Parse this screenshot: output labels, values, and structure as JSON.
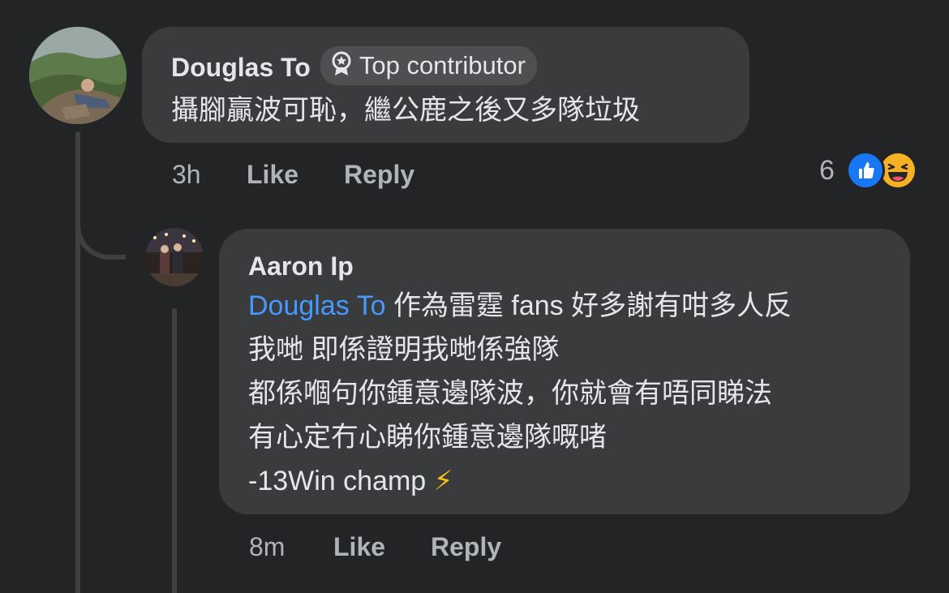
{
  "comment": {
    "author": "Douglas To",
    "badge_label": "Top contributor",
    "text": "攝腳贏波可恥，繼公鹿之後又多隊垃圾",
    "time": "3h",
    "like_label": "Like",
    "reply_label": "Reply",
    "reaction_count": "6",
    "reaction_icons": [
      "like-icon",
      "haha-icon"
    ]
  },
  "reply": {
    "author": "Aaron Ip",
    "mention": "Douglas To",
    "first_line_rest": " 作為雷霆 fans 好多謝有咁多人反",
    "lines": [
      "我哋 即係證明我哋係強隊",
      "都係嗰句你鍾意邊隊波，你就會有唔同睇法",
      "有心定冇心睇你鍾意邊隊嘅啫"
    ],
    "last_line": "-13Win champ ",
    "emoji": "⚡",
    "time": "8m",
    "like_label": "Like",
    "reply_label": "Reply"
  },
  "colors": {
    "background": "#232425",
    "bubble": "#3a3b3c",
    "mention": "#4599ff",
    "like_blue": "#1877f2",
    "secondary_text": "#b0b3b8"
  }
}
